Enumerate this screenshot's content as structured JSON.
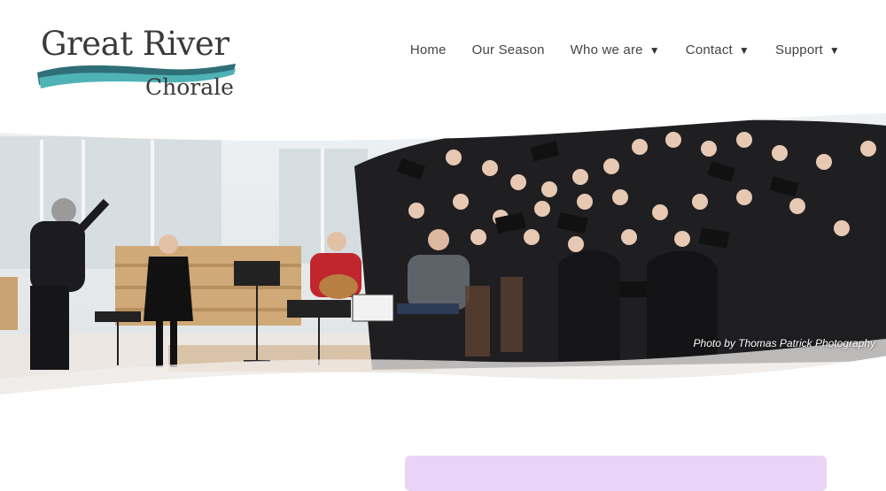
{
  "logo": {
    "title": "Great River",
    "subtitle": "Chorale"
  },
  "nav": {
    "home": "Home",
    "season": "Our Season",
    "who": "Who we are",
    "contact": "Contact",
    "support": "Support",
    "caret": "▼"
  },
  "hero": {
    "credit": "Photo by Thomas Patrick Photography"
  },
  "colors": {
    "wave_dark": "#2f6f78",
    "wave_light": "#4fb2b5",
    "promo_box": "#e9d4f7",
    "text": "#444444"
  }
}
